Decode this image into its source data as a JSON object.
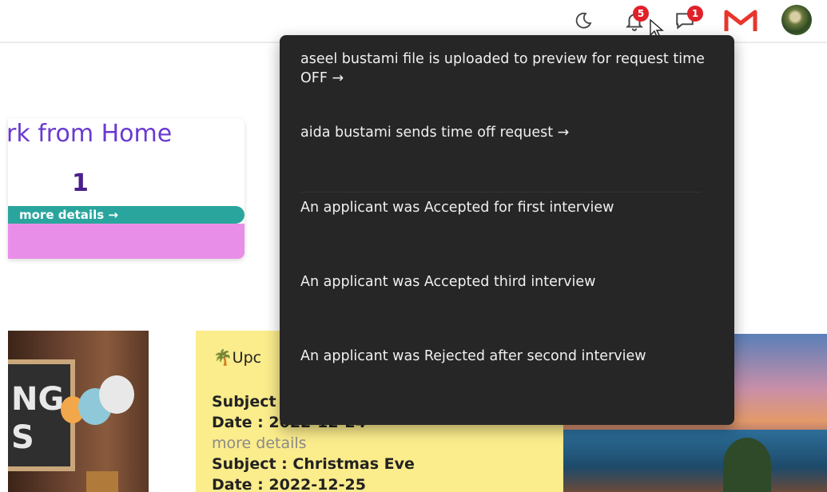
{
  "header": {
    "theme_toggle_icon": "moon-icon",
    "notifications": {
      "icon": "bell-icon",
      "count": "5"
    },
    "messages": {
      "icon": "chat-icon",
      "count": "1"
    },
    "mail_icon": "gmail-icon",
    "avatar_icon": "avatar"
  },
  "stat_card": {
    "title": "rk from Home",
    "count": "1",
    "more_link": "more details →"
  },
  "events_card": {
    "title": "Upc",
    "title_icon": "palm-tree-icon",
    "items": [
      {
        "subject": "Subject",
        "date": "Date : 2022-12-24",
        "more_link": "more details"
      },
      {
        "subject": "Subject : Christmas Eve",
        "date": "Date : 2022-12-25"
      }
    ]
  },
  "left_image": {
    "chalk_text": "NG\nS"
  },
  "notifications_dropdown": {
    "items": [
      {
        "text": "aseel bustami file is uploaded to preview for request time OFF →"
      },
      {
        "text": "aida bustami sends time off request →"
      },
      {
        "text": "An applicant was Accepted for first interview"
      },
      {
        "text": "An applicant was Accepted third interview"
      },
      {
        "text": "An applicant was Rejected after second interview"
      }
    ]
  },
  "colors": {
    "dropdown_bg": "#262626",
    "badge": "#e0202a",
    "stat_title": "#6a3ad0",
    "more_bar": "#2aa59d",
    "card_pink": "#e98ee8",
    "events_yellow": "#fbec8c"
  }
}
